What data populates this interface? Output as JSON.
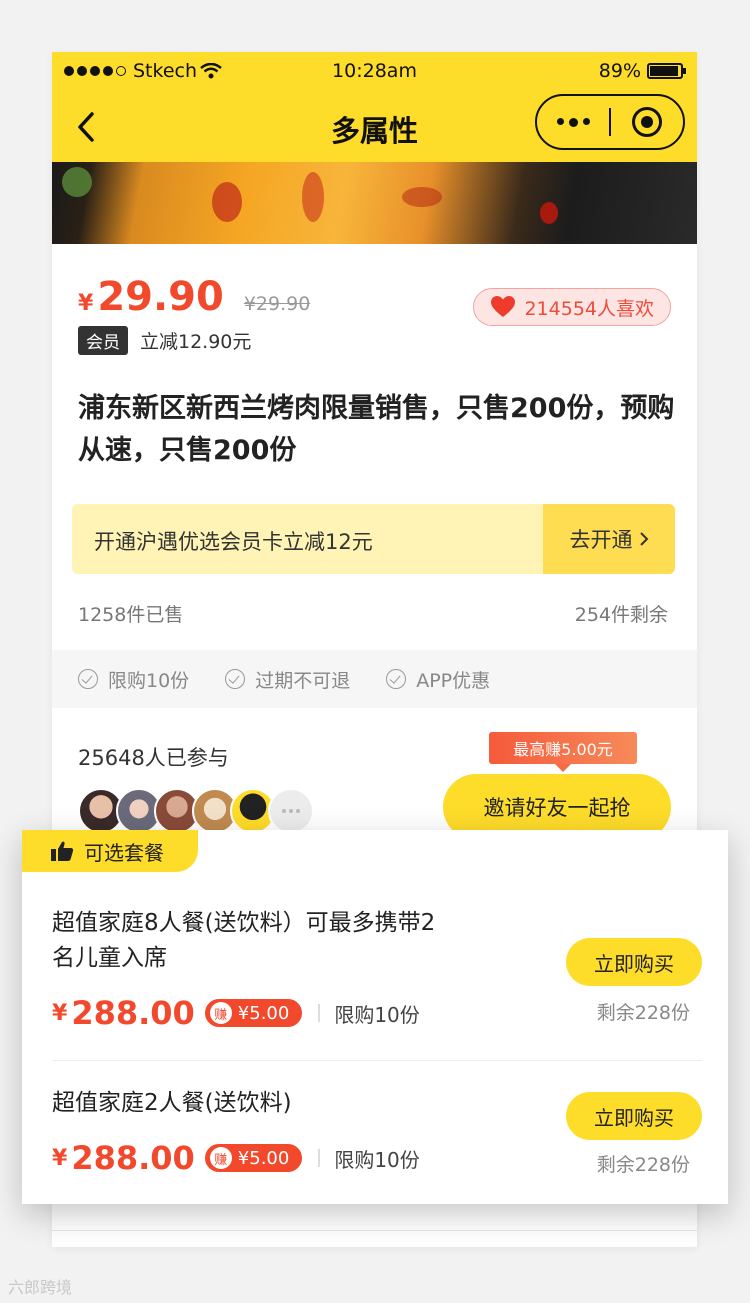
{
  "status": {
    "carrier": "Stkech",
    "time": "10:28am",
    "battery": "89%"
  },
  "nav": {
    "title": "多属性"
  },
  "product": {
    "currency": "¥",
    "price": "29.90",
    "original_price": "¥29.90",
    "member_tag": "会员",
    "member_discount": "立减12.90元",
    "likes": "214554人喜欢",
    "title": "浦东新区新西兰烤肉限量销售，只售200份，预购从速，只售200份"
  },
  "vip": {
    "text": "开通沪遇优选会员卡立减12元",
    "button": "去开通"
  },
  "sales": {
    "sold": "1258件已售",
    "remaining": "254件剩余"
  },
  "tags": [
    "限购10份",
    "过期不可退",
    "APP优惠"
  ],
  "group": {
    "participants": "25648人已参与",
    "earn_bubble": "最高赚5.00元",
    "invite_button": "邀请好友一起抢"
  },
  "packages": {
    "tab_label": "可选套餐",
    "items": [
      {
        "name": "超值家庭8人餐(送饮料）可最多携带2名儿童入席",
        "currency": "¥",
        "price": "288.00",
        "earn_icon": "赚",
        "earn": "¥5.00",
        "limit": "限购10份",
        "buy": "立即购买",
        "remain": "剩余228份"
      },
      {
        "name": "超值家庭2人餐(送饮料)",
        "currency": "¥",
        "price": "288.00",
        "earn_icon": "赚",
        "earn": "¥5.00",
        "limit": "限购10份",
        "buy": "立即购买",
        "remain": "剩余228份"
      }
    ]
  },
  "watermark": "六郎跨境",
  "colors": {
    "brand_yellow": "#fedc2a",
    "price_red": "#f2492c"
  }
}
